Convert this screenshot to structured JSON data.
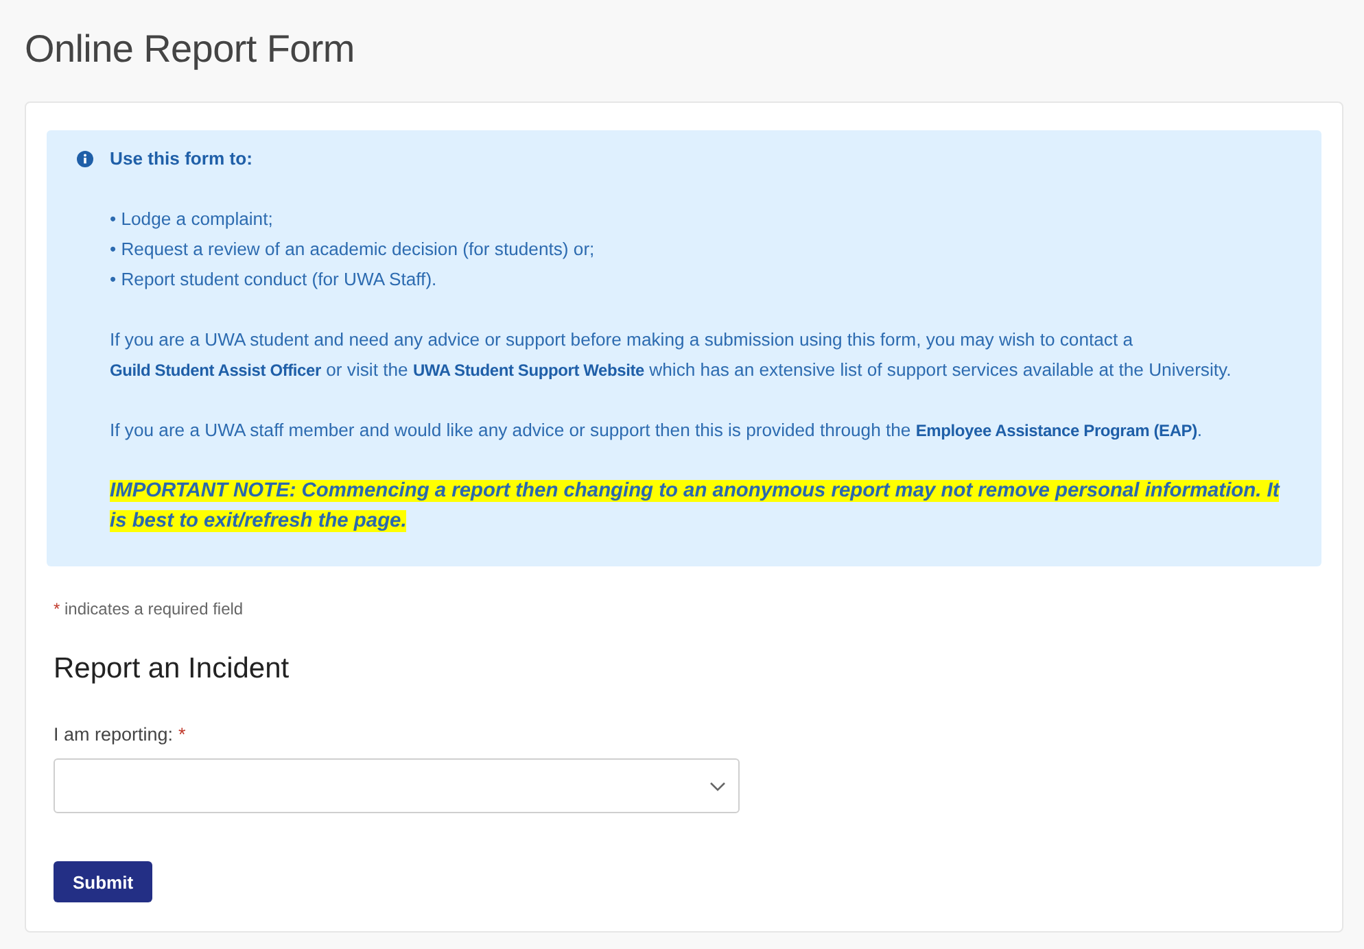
{
  "page": {
    "title": "Online Report Form"
  },
  "info_box": {
    "heading": "Use this form to:",
    "bullets": [
      "• Lodge a complaint;",
      "• Request a review of an academic decision (for students) or;",
      "• Report student conduct (for UWA Staff)."
    ],
    "paragraphs": [
      {
        "segments": [
          {
            "kind": "text",
            "text": "If you are a UWA student and need any advice or support before making a submission using this form, you may wish to contact a "
          },
          {
            "kind": "link",
            "text": "Guild Student Assist Officer"
          },
          {
            "kind": "text",
            "text": " or visit the "
          },
          {
            "kind": "link",
            "text": "UWA Student Support Website"
          },
          {
            "kind": "text",
            "text": " which has an extensive list of support services available at the University."
          }
        ]
      },
      {
        "segments": [
          {
            "kind": "text",
            "text": "If you are a UWA staff member and would like any advice or support then this is provided through the "
          },
          {
            "kind": "link",
            "text": "Employee Assistance Program (EAP)"
          },
          {
            "kind": "text",
            "text": "."
          }
        ]
      }
    ],
    "important_note": "IMPORTANT NOTE: Commencing a report then changing to an anonymous report may not remove personal information. It is best to exit/refresh the page."
  },
  "required_note": {
    "marker": "*",
    "text": "indicates a required field"
  },
  "section": {
    "heading": "Report an Incident",
    "fields": [
      {
        "kind": "select",
        "label": "I am reporting:",
        "marker": "*"
      }
    ]
  },
  "buttons": [
    {
      "label": "Submit"
    }
  ]
}
